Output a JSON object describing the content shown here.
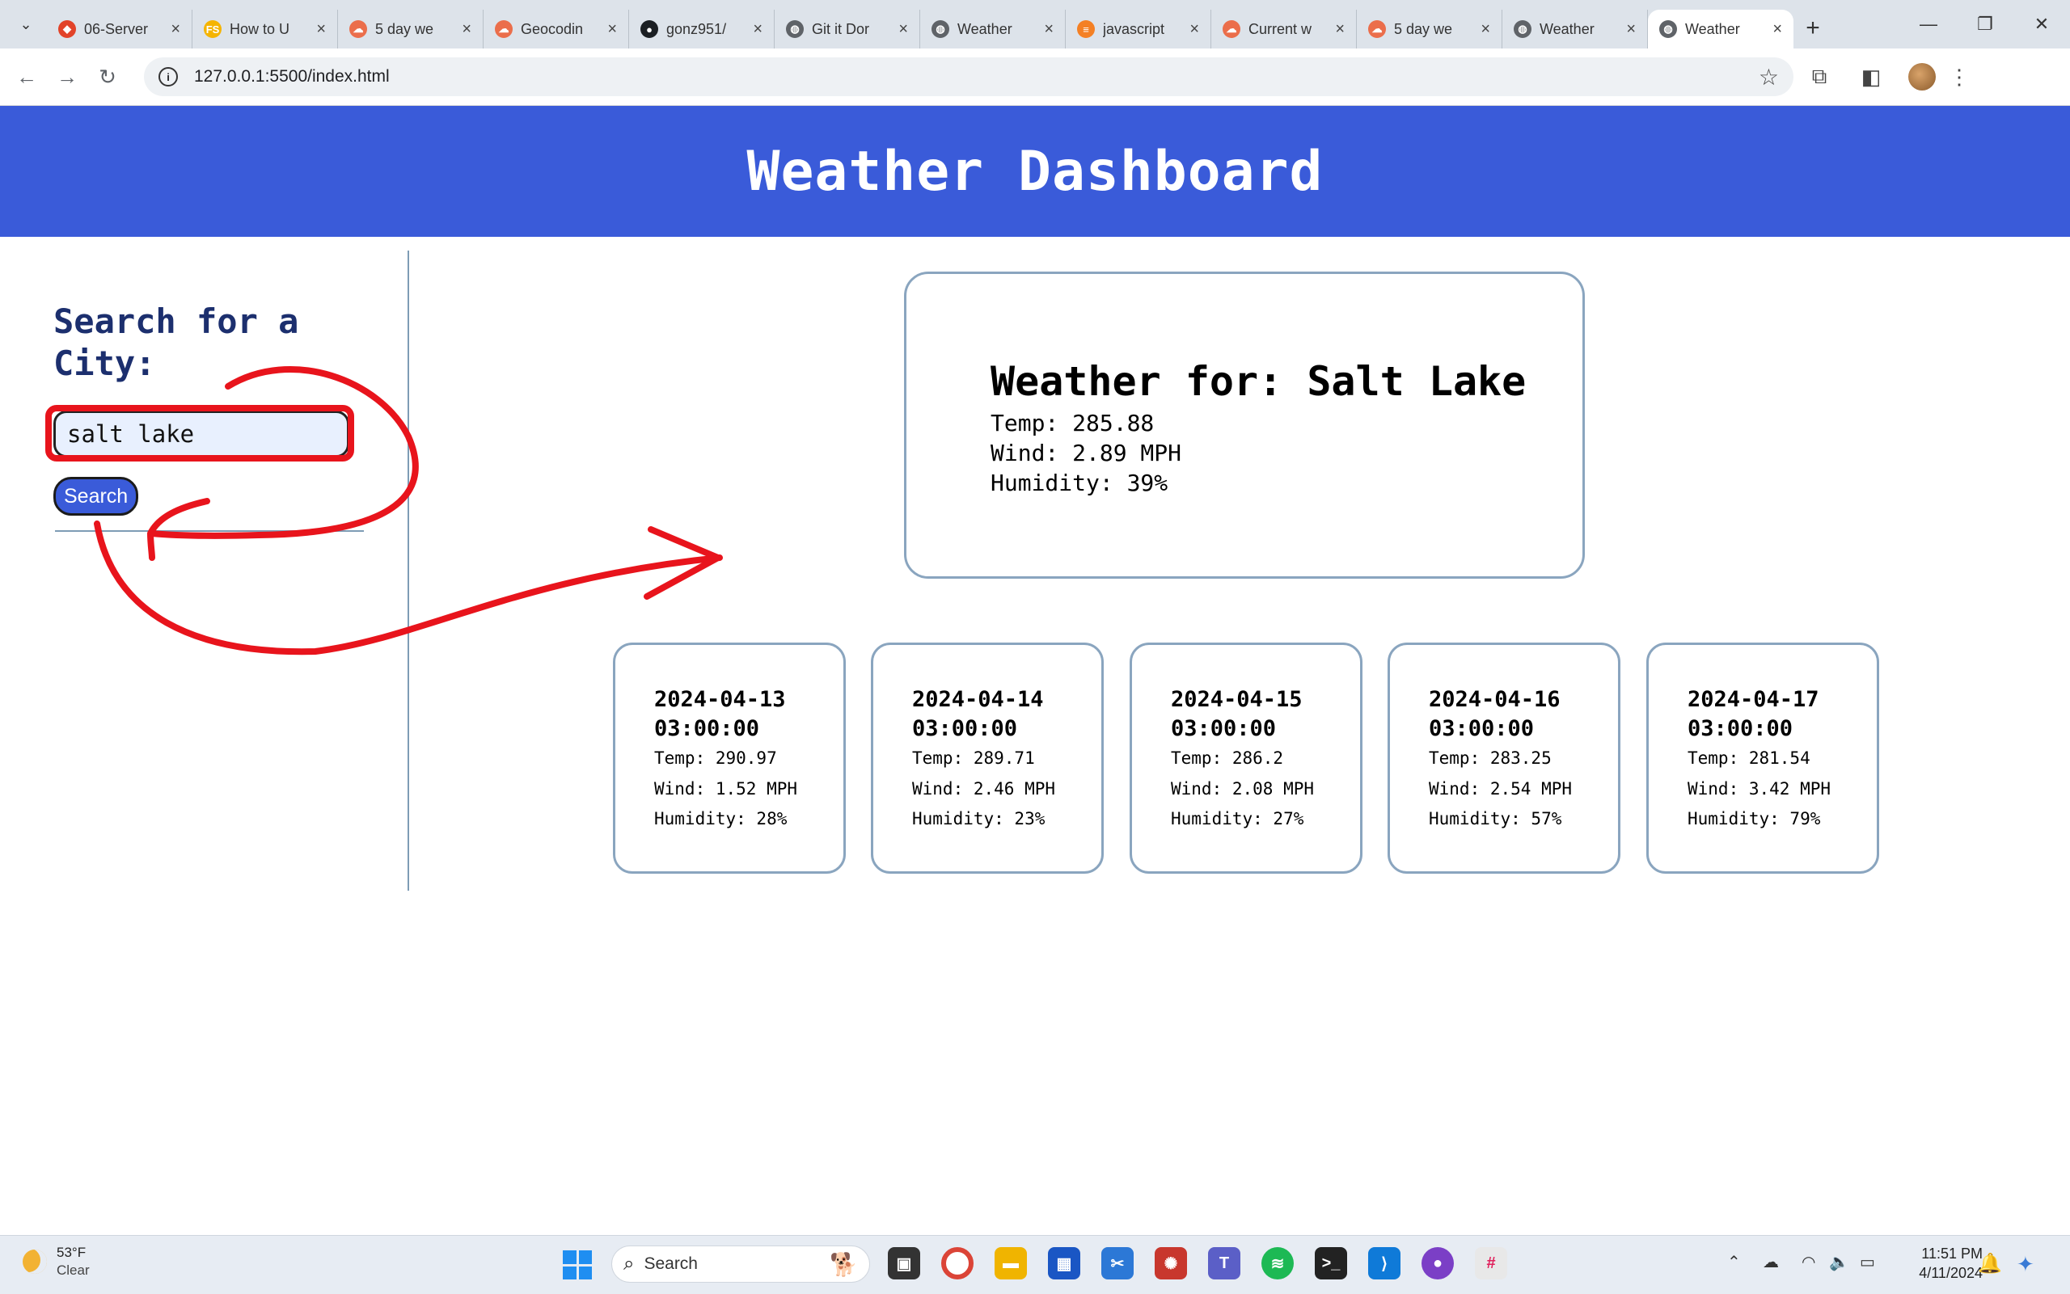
{
  "browser": {
    "tabs": [
      {
        "title": "06-Server",
        "favicon": "gitlab-icon",
        "color": "#e24329",
        "glyph": "◆"
      },
      {
        "title": "How to U",
        "favicon": "fs-icon",
        "color": "#f5b400",
        "glyph": "FS"
      },
      {
        "title": "5 day we",
        "favicon": "openweather-icon",
        "color": "#eb6e4b",
        "glyph": "☁"
      },
      {
        "title": "Geocodin",
        "favicon": "openweather-icon",
        "color": "#eb6e4b",
        "glyph": "☁"
      },
      {
        "title": "gonz951/",
        "favicon": "github-icon",
        "color": "#1b1f23",
        "glyph": "●"
      },
      {
        "title": "Git it Dor",
        "favicon": "globe-icon",
        "color": "#5f6368",
        "glyph": "◍"
      },
      {
        "title": "Weather",
        "favicon": "globe-icon",
        "color": "#5f6368",
        "glyph": "◍"
      },
      {
        "title": "javascript",
        "favicon": "stackoverflow-icon",
        "color": "#f48024",
        "glyph": "≡"
      },
      {
        "title": "Current w",
        "favicon": "openweather-icon",
        "color": "#eb6e4b",
        "glyph": "☁"
      },
      {
        "title": "5 day we",
        "favicon": "openweather-icon",
        "color": "#eb6e4b",
        "glyph": "☁"
      },
      {
        "title": "Weather",
        "favicon": "globe-icon",
        "color": "#5f6368",
        "glyph": "◍"
      },
      {
        "title": "Weather",
        "favicon": "globe-icon",
        "color": "#5f6368",
        "glyph": "◍"
      }
    ],
    "active_tab": 11,
    "url": "127.0.0.1:5500/index.html"
  },
  "page": {
    "title": "Weather Dashboard",
    "search_heading": "Search for a City:",
    "search_value": "salt lake",
    "search_button": "Search"
  },
  "current": {
    "heading": "Weather for: Salt Lake",
    "temp": "Temp: 285.88",
    "wind": "Wind: 2.89 MPH",
    "humidity": "Humidity: 39%"
  },
  "forecast": [
    {
      "date": "2024-04-13 03:00:00",
      "temp": "Temp: 290.97",
      "wind": "Wind: 1.52 MPH",
      "humidity": "Humidity: 28%"
    },
    {
      "date": "2024-04-14 03:00:00",
      "temp": "Temp: 289.71",
      "wind": "Wind: 2.46 MPH",
      "humidity": "Humidity: 23%"
    },
    {
      "date": "2024-04-15 03:00:00",
      "temp": "Temp: 286.2",
      "wind": "Wind: 2.08 MPH",
      "humidity": "Humidity: 27%"
    },
    {
      "date": "2024-04-16 03:00:00",
      "temp": "Temp: 283.25",
      "wind": "Wind: 2.54 MPH",
      "humidity": "Humidity: 57%"
    },
    {
      "date": "2024-04-17 03:00:00",
      "temp": "Temp: 281.54",
      "wind": "Wind: 3.42 MPH",
      "humidity": "Humidity: 79%"
    }
  ],
  "taskbar": {
    "weather_temp": "53°F",
    "weather_desc": "Clear",
    "search_label": "Search",
    "time": "11:51 PM",
    "date": "4/11/2024"
  },
  "colors": {
    "header": "#3a5bd9",
    "annotation": "#e8141c",
    "card_border": "#8aa5bf"
  }
}
